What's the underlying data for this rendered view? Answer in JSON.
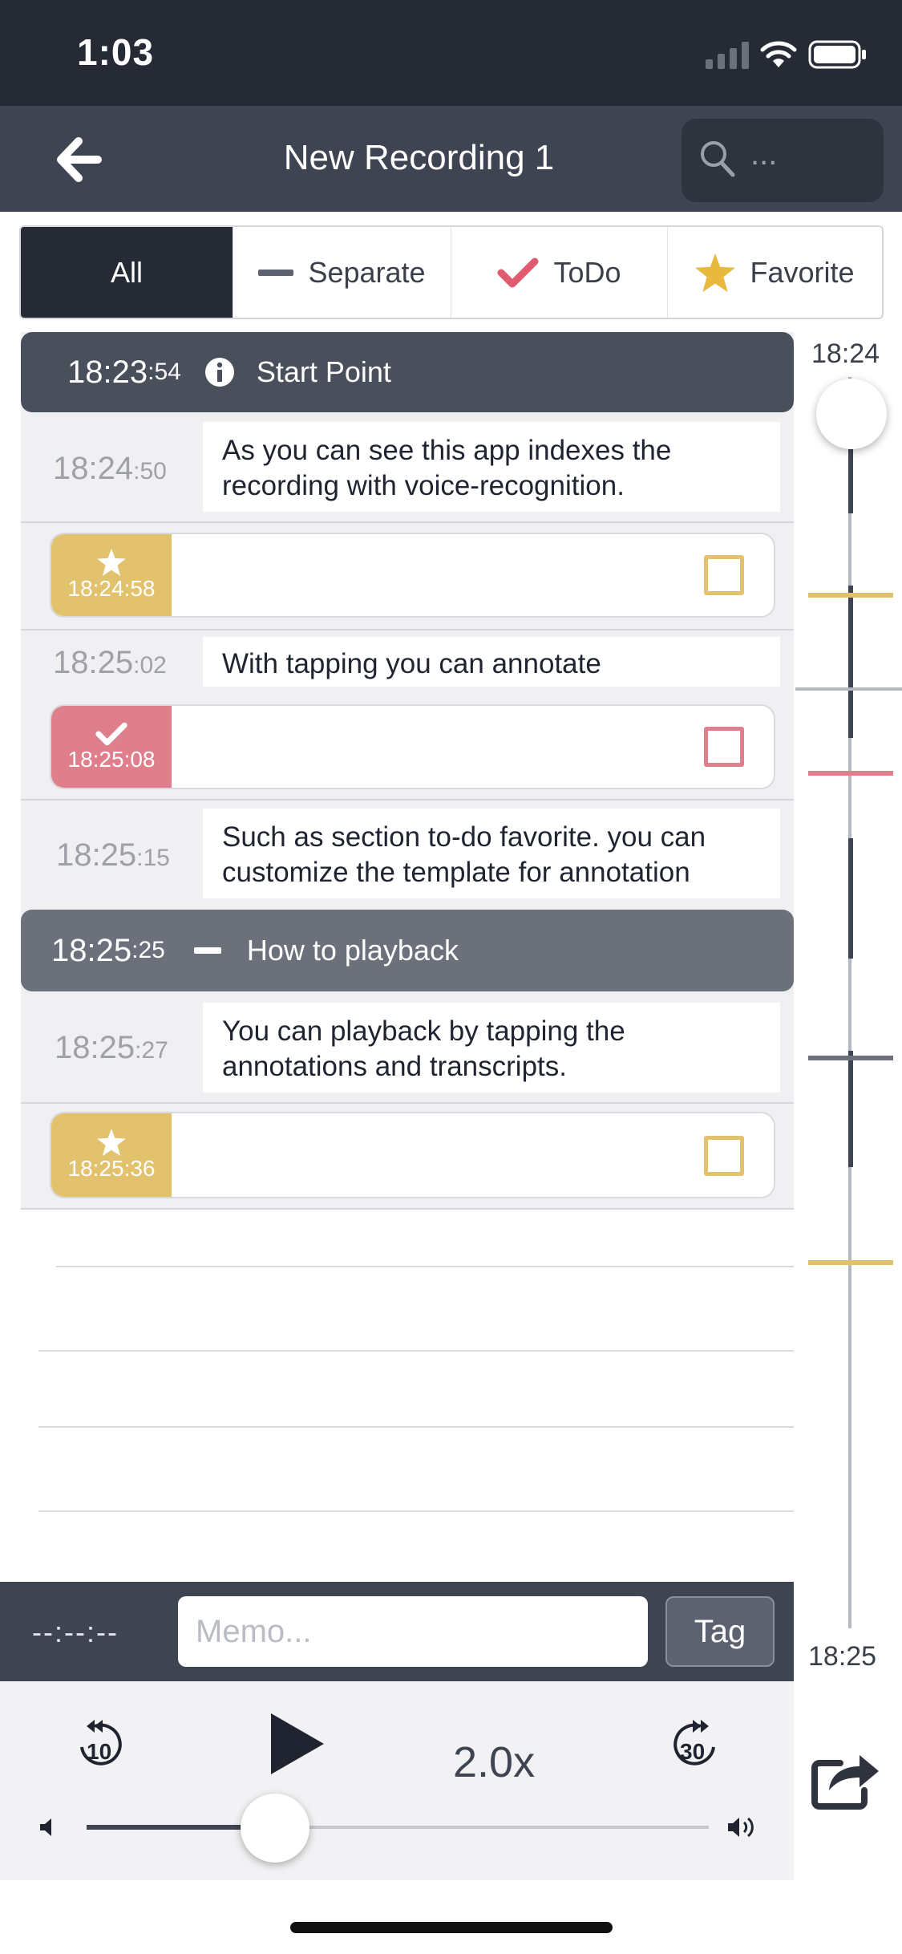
{
  "status": {
    "time": "1:03"
  },
  "nav": {
    "title": "New Recording 1",
    "search_placeholder": "..."
  },
  "filters": [
    {
      "label": "All"
    },
    {
      "label": "Separate"
    },
    {
      "label": "ToDo"
    },
    {
      "label": "Favorite"
    }
  ],
  "sections": [
    {
      "time_main": "18:23",
      "time_sec": ":54",
      "label": "Start Point"
    },
    {
      "time_main": "18:25",
      "time_sec": ":25",
      "label": "How to playback"
    }
  ],
  "transcripts": [
    {
      "time_main": "18:24",
      "time_sec": ":50",
      "text_line1": "As you can see this app indexes the",
      "text_line2": "recording with voice-recognition."
    },
    {
      "time_main": "18:25",
      "time_sec": ":02",
      "text_line1": "With tapping you can annotate",
      "text_line2": ""
    },
    {
      "time_main": "18:25",
      "time_sec": ":15",
      "text_line1": "Such as section to-do favorite. you can",
      "text_line2": "customize the template for annotation"
    },
    {
      "time_main": "18:25",
      "time_sec": ":27",
      "text_line1": "You can playback by tapping the",
      "text_line2": "annotations and transcripts."
    }
  ],
  "annotations": [
    {
      "type": "favorite",
      "time": "18:24:58",
      "color": "#e3c26e"
    },
    {
      "type": "todo",
      "time": "18:25:08",
      "color": "#e07f8c"
    },
    {
      "type": "favorite",
      "time": "18:25:36",
      "color": "#e3c26e"
    }
  ],
  "timeline": {
    "start_label": "18:24",
    "end_label": "18:25"
  },
  "memo": {
    "time_display": "--:--:--",
    "placeholder": "Memo...",
    "tag_label": "Tag"
  },
  "player": {
    "speed": "2.0x",
    "rewind_seconds": "10",
    "forward_seconds": "30",
    "volume_level": 0.3
  },
  "colors": {
    "dark": "#252a35",
    "header": "#3e4452",
    "favorite": "#e3c26e",
    "todo": "#e07f8c"
  }
}
